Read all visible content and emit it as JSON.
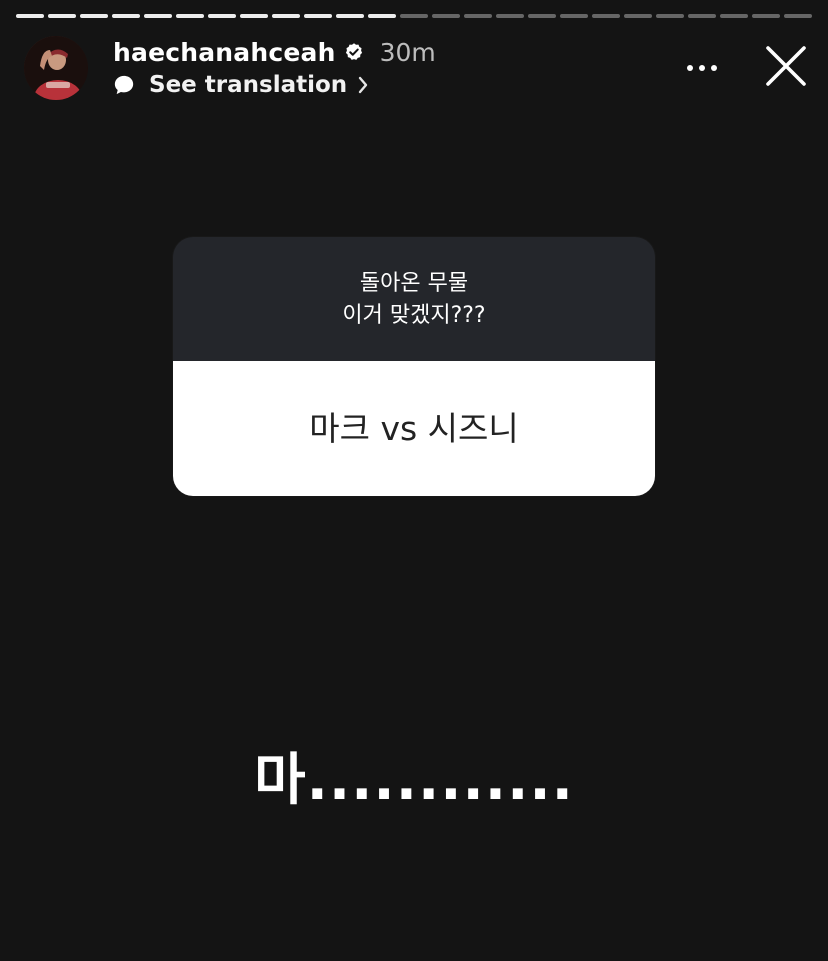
{
  "progress": {
    "segments_total": 25,
    "segments_done": 12
  },
  "header": {
    "username": "haechanahceah",
    "verified": true,
    "time_ago": "30m",
    "translation_label": "See translation",
    "icons": {
      "verified": "verified-badge-icon",
      "translation": "speech-bubble-icon",
      "chevron": "chevron-right-icon",
      "more": "more-options-icon",
      "close": "close-icon"
    }
  },
  "sticker": {
    "question_line1": "돌아온 무물",
    "question_line2": "이거 맞겠지???",
    "answer": "마크 vs 시즈니"
  },
  "caption": {
    "text": "마............"
  },
  "colors": {
    "background": "#141414",
    "sticker_header": "#24262b",
    "sticker_body": "#ffffff",
    "text_primary": "#ffffff",
    "answer_text": "#222222"
  }
}
